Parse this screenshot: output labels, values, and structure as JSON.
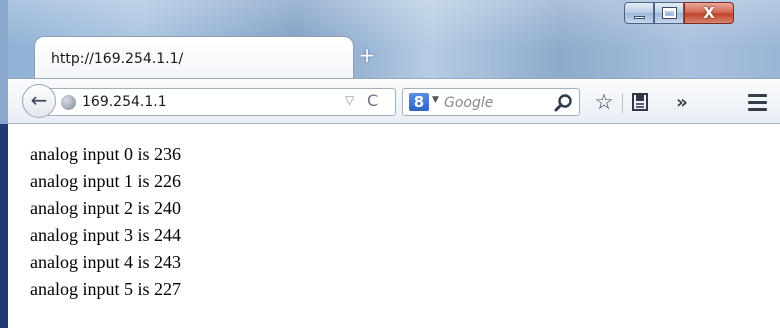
{
  "tab": {
    "title": "http://169.254.1.1/",
    "new_tab_label": "+"
  },
  "window_controls": {
    "close_label": "X"
  },
  "nav": {
    "back_label": "←",
    "url": "169.254.1.1",
    "dropmarker": "▽",
    "reload": "C",
    "search_engine_letter": "8",
    "search_placeholder": "Google",
    "overflow_label": "»",
    "star_label": "☆"
  },
  "content": {
    "lines": [
      "analog input 0 is 236",
      "analog input 1 is 226",
      "analog input 2 is 240",
      "analog input 3 is 244",
      "analog input 4 is 243",
      "analog input 5 is 227"
    ]
  }
}
